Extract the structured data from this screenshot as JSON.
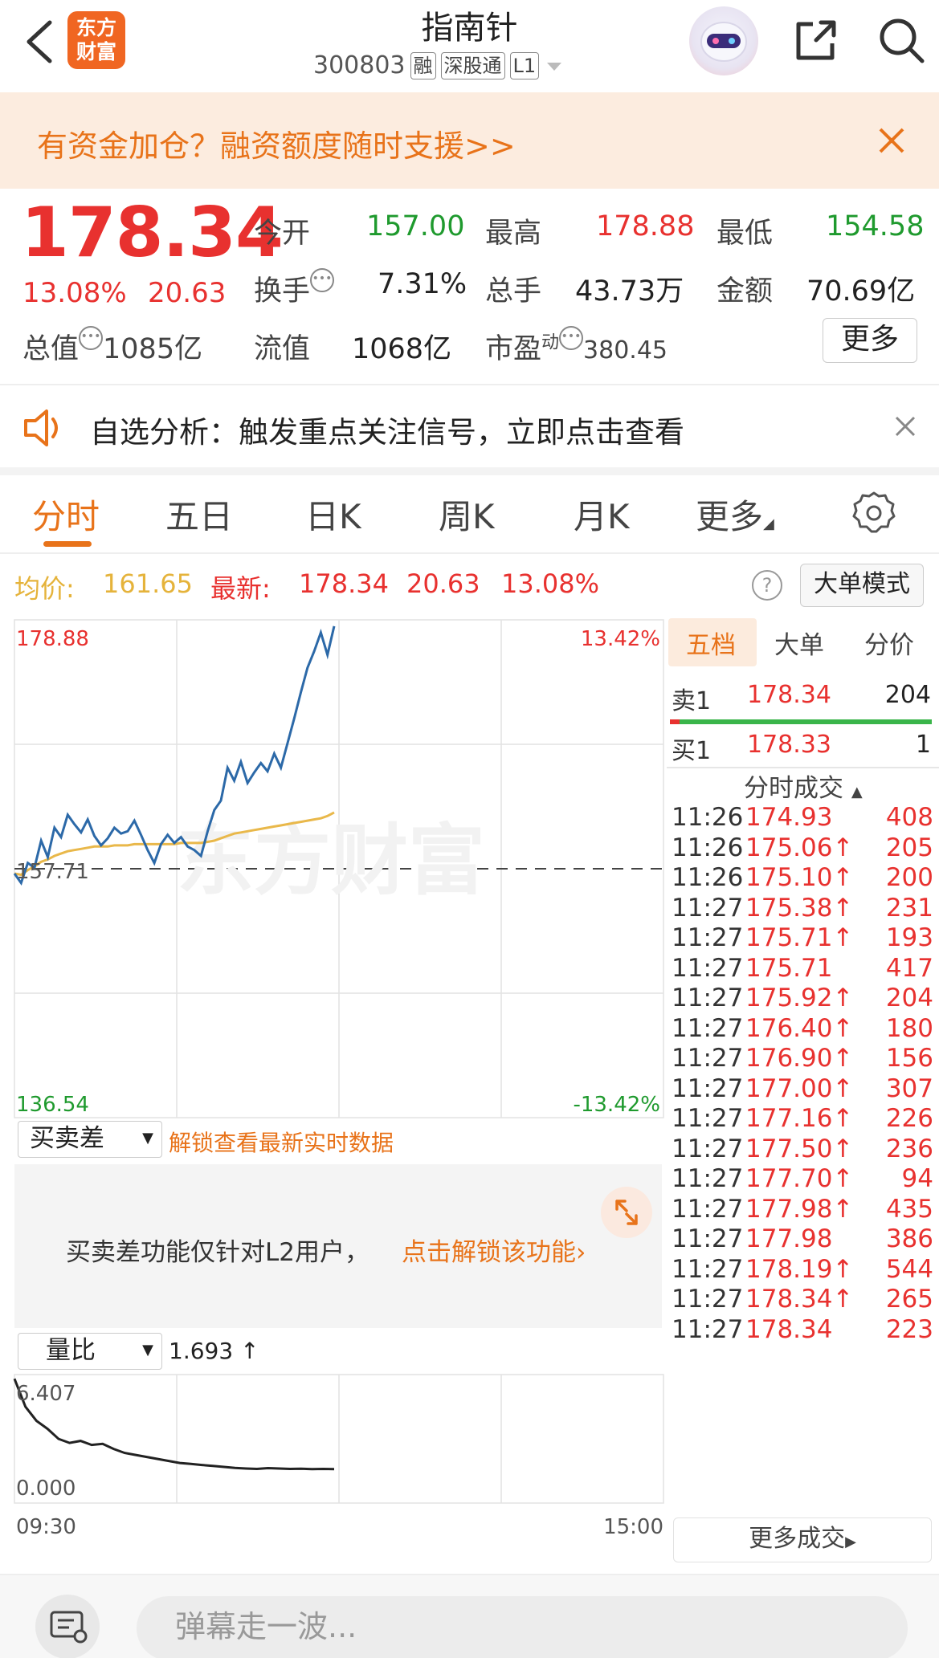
{
  "header": {
    "logo_line1": "东方",
    "logo_line2": "财富",
    "stock_name": "指南针",
    "stock_code": "300803",
    "tags": [
      "融",
      "深股通",
      "L1"
    ]
  },
  "promo": {
    "text": "有资金加仓？融资额度随时支援>>"
  },
  "quote": {
    "price": "178.34",
    "change_pct": "13.08%",
    "change_amt": "20.63",
    "open_label": "今开",
    "open": "157.00",
    "high_label": "最高",
    "high": "178.88",
    "low_label": "最低",
    "low": "154.58",
    "turnover_label": "换手",
    "turnover": "7.31%",
    "volume_label": "总手",
    "volume": "43.73万",
    "amount_label": "金额",
    "amount": "70.69亿",
    "mktcap_label": "总值",
    "mktcap": "1085亿",
    "float_label": "流值",
    "float": "1068亿",
    "pe_label": "市盈",
    "pe_sup": "动",
    "pe": "380.45",
    "more_label": "更多"
  },
  "notice": {
    "text": "自选分析：触发重点关注信号，立即点击查看"
  },
  "tabs": [
    "分时",
    "五日",
    "日K",
    "周K",
    "月K",
    "更多"
  ],
  "priceline": {
    "avg_label": "均价:",
    "avg": "161.65",
    "latest_label": "最新:",
    "latest": "178.34",
    "latest_chg": "20.63",
    "latest_pct": "13.08%",
    "big_order_label": "大单模式"
  },
  "chart": {
    "y_high": "178.88",
    "y_low": "136.54",
    "pct_high": "13.42%",
    "pct_low": "-13.42%",
    "prev_close": "157.71",
    "watermark": "东方财富",
    "time_start": "09:30",
    "time_end": "15:00"
  },
  "chart_data": {
    "type": "line",
    "ylim": [
      136.54,
      178.88
    ],
    "prev_close": 157.71,
    "series": [
      {
        "name": "",
        "values": [
          157.3,
          156.5,
          158.2,
          157.8,
          160.1,
          158.7,
          161.2,
          160.4,
          162.3,
          161.5,
          160.8,
          161.9,
          160.5,
          159.7,
          160.3,
          161.2,
          160.7,
          160.9,
          161.8,
          160.6,
          159.3,
          158.2,
          159.8,
          160.6,
          159.9,
          160.4,
          159.6,
          159.3,
          158.8,
          160.9,
          162.7,
          163.5,
          166.3,
          165.2,
          166.8,
          165.0,
          165.9,
          166.7,
          166.0,
          167.5,
          166.3,
          168.4,
          170.5,
          172.7,
          174.8,
          176.2,
          177.8,
          175.9,
          178.34
        ]
      },
      {
        "name": "",
        "values": [
          157.3,
          157.2,
          157.6,
          157.9,
          158.3,
          158.5,
          158.8,
          159.0,
          159.2,
          159.3,
          159.4,
          159.5,
          159.6,
          159.6,
          159.6,
          159.7,
          159.7,
          159.7,
          159.8,
          159.8,
          159.8,
          159.8,
          159.8,
          159.8,
          159.8,
          159.9,
          159.9,
          159.9,
          159.9,
          160.0,
          160.1,
          160.3,
          160.5,
          160.7,
          160.8,
          160.9,
          161.0,
          161.1,
          161.2,
          161.3,
          161.4,
          161.5,
          161.6,
          161.7,
          161.8,
          161.9,
          162.0,
          162.2,
          162.5
        ]
      }
    ]
  },
  "orderbook": {
    "tabs": [
      "五档",
      "大单",
      "分价"
    ],
    "sell1_label": "卖1",
    "sell1_price": "178.34",
    "sell1_vol": "204",
    "buy1_label": "买1",
    "buy1_price": "178.33",
    "buy1_vol": "1",
    "trades_title": "分时成交",
    "trades": [
      {
        "t": "11:26",
        "p": "174.93",
        "v": "408"
      },
      {
        "t": "11:26",
        "p": "175.06↑",
        "v": "205"
      },
      {
        "t": "11:26",
        "p": "175.10↑",
        "v": "200"
      },
      {
        "t": "11:27",
        "p": "175.38↑",
        "v": "231"
      },
      {
        "t": "11:27",
        "p": "175.71↑",
        "v": "193"
      },
      {
        "t": "11:27",
        "p": "175.71",
        "v": "417"
      },
      {
        "t": "11:27",
        "p": "175.92↑",
        "v": "204"
      },
      {
        "t": "11:27",
        "p": "176.40↑",
        "v": "180"
      },
      {
        "t": "11:27",
        "p": "176.90↑",
        "v": "156"
      },
      {
        "t": "11:27",
        "p": "177.00↑",
        "v": "307"
      },
      {
        "t": "11:27",
        "p": "177.16↑",
        "v": "226"
      },
      {
        "t": "11:27",
        "p": "177.50↑",
        "v": "236"
      },
      {
        "t": "11:27",
        "p": "177.70↑",
        "v": "94"
      },
      {
        "t": "11:27",
        "p": "177.98↑",
        "v": "435"
      },
      {
        "t": "11:27",
        "p": "177.98",
        "v": "386"
      },
      {
        "t": "11:27",
        "p": "178.19↑",
        "v": "544"
      },
      {
        "t": "11:27",
        "p": "178.34↑",
        "v": "265"
      },
      {
        "t": "11:27",
        "p": "178.34",
        "v": "223"
      }
    ],
    "more_trades": "更多成交"
  },
  "bsd": {
    "dropdown": "买卖差",
    "unlock_link": "解锁查看最新实时数据",
    "panel_text": "买卖差功能仅针对L2用户，",
    "panel_link": "点击解锁该功能"
  },
  "volratio": {
    "dropdown": "量比",
    "value": "1.693",
    "y_high": "6.407",
    "y_low": "0.000",
    "values": [
      6.2,
      4.8,
      4.1,
      3.7,
      3.2,
      3.0,
      3.1,
      2.9,
      2.95,
      2.7,
      2.5,
      2.4,
      2.3,
      2.2,
      2.1,
      2.0,
      1.95,
      1.9,
      1.85,
      1.8,
      1.75,
      1.72,
      1.7,
      1.74,
      1.72,
      1.7,
      1.71,
      1.69,
      1.7,
      1.693
    ]
  },
  "bottom": {
    "danmu_placeholder": "弹幕走一波..."
  }
}
